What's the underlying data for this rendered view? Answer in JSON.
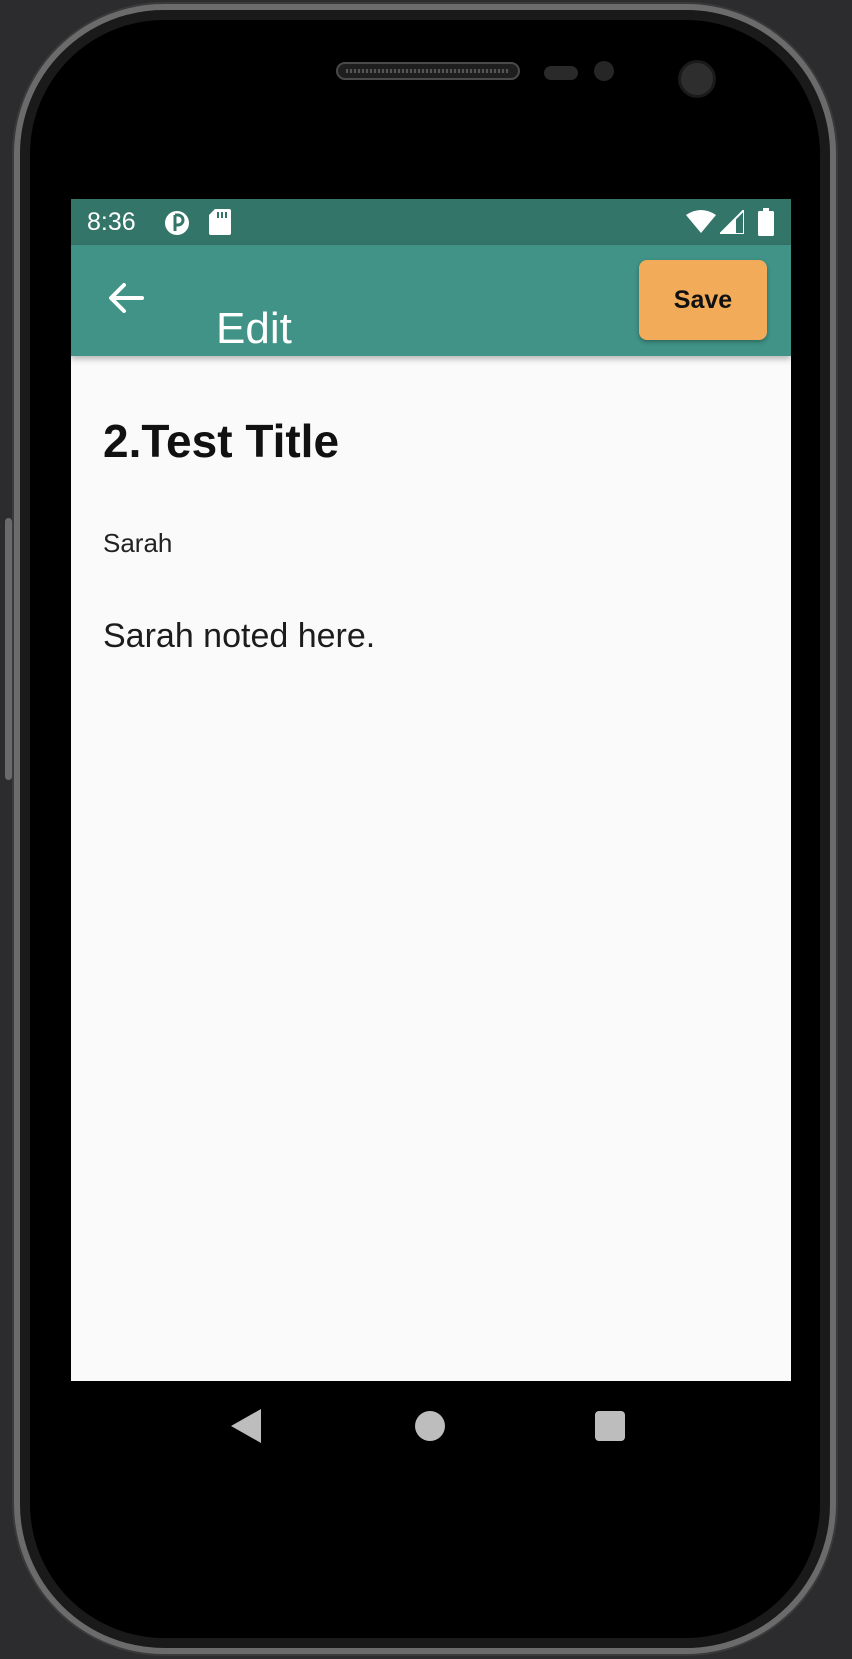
{
  "status_bar": {
    "time": "8:36",
    "icons": [
      "vpn-key-icon",
      "sd-card-icon",
      "wifi-icon",
      "cellular-signal-icon",
      "battery-icon"
    ]
  },
  "app_bar": {
    "title": "Edit",
    "save_label": "Save",
    "back_icon": "arrow-back-icon"
  },
  "note": {
    "title": "2.Test Title",
    "author": "Sarah",
    "body": "Sarah noted here."
  },
  "nav_bar": {
    "buttons": [
      "back-triangle-icon",
      "home-circle-icon",
      "recents-square-icon"
    ]
  },
  "colors": {
    "status_bar": "#34756a",
    "app_bar": "#409386",
    "save_button": "#f2ab59",
    "content_background": "#fafafa"
  }
}
